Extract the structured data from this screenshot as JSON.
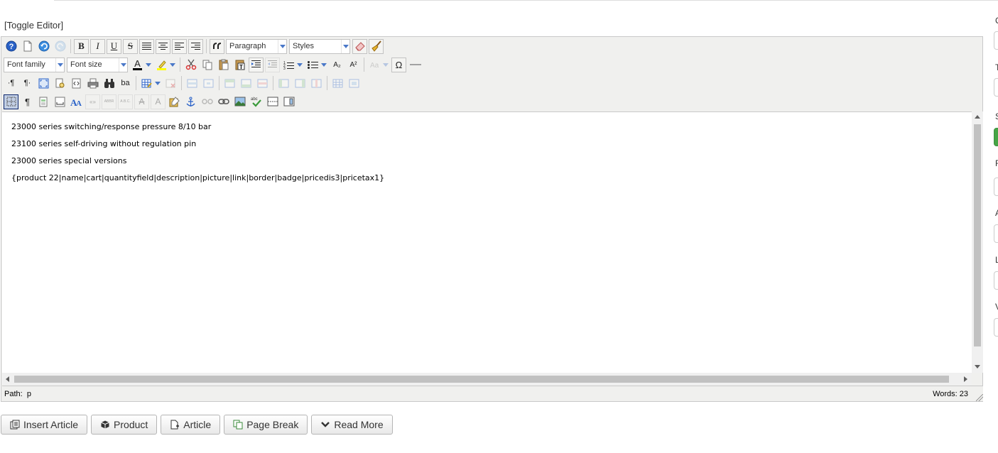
{
  "toggle_editor": "[Toggle Editor]",
  "toolbar": {
    "bold_label": "B",
    "italic_label": "I",
    "underline_label": "U",
    "strike_label": "S",
    "format_select": "Paragraph",
    "styles_select": "Styles",
    "font_family_select": "Font family",
    "font_size_select": "Font size",
    "font_color_letter": "A",
    "subscript_label": "A₂",
    "superscript_label": "A²",
    "omega_label": "Ω",
    "ltr_label": "·¶",
    "rtl_label": "¶·",
    "pilcrow_label": "¶",
    "cite_label": "«»",
    "abbr_label": "ABBR",
    "acronym_label": "A.B.C.",
    "styleprops_label": "A",
    "ins_label": "A",
    "spell_label": "abc",
    "ba_label": "ba"
  },
  "colors": {
    "font_color_indicator": "#000000",
    "highlight_indicator": "#ffff00",
    "accent_blue": "#4a78c8",
    "active_border": "#0a246a"
  },
  "content": {
    "lines": [
      "23000 series switching/response pressure 8/10 bar",
      "23100 series self-driving without regulation pin",
      "23000 series special versions",
      "{product 22|name|cart|quantityfield|description|picture|link|border|badge|pricedis3|pricetax1}"
    ]
  },
  "status": {
    "path_label": "Path:",
    "path_value": "p",
    "words": "Words: 23"
  },
  "buttons": {
    "insert_article": "Insert Article",
    "product": "Product",
    "article": "Article",
    "page_break": "Page Break",
    "read_more": "Read More"
  },
  "right_panel": {
    "labels": [
      "C",
      "T",
      "S",
      "F",
      "A",
      "L",
      "V"
    ]
  }
}
